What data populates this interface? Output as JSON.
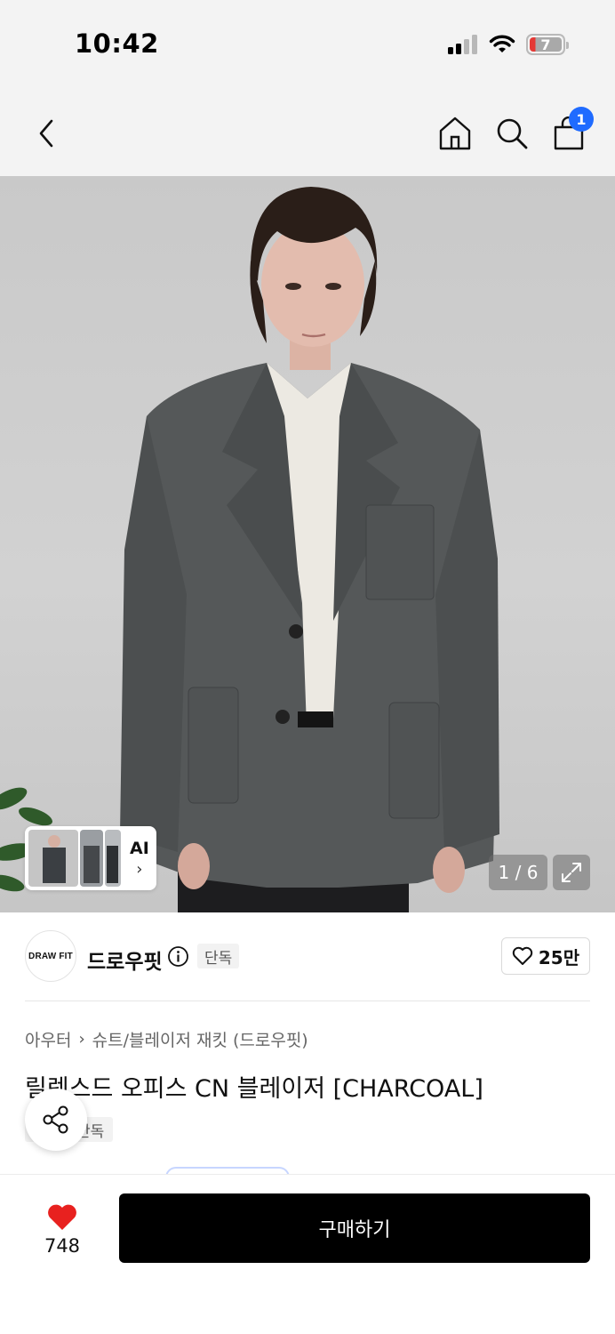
{
  "status_bar": {
    "time": "10:42",
    "battery_level": "7",
    "icons": [
      "cellular-signal-icon",
      "wifi-icon",
      "battery-icon"
    ]
  },
  "nav": {
    "icons": [
      "back-chevron-icon",
      "home-icon",
      "search-icon",
      "shopping-bag-icon"
    ],
    "cart_count": "1"
  },
  "gallery": {
    "ai_label": "AI",
    "ai_chevron": "›",
    "current_page": 1,
    "total_pages": 6,
    "counter_text": "1 / 6"
  },
  "brand": {
    "logo_text": "DRAW FIT",
    "name": "드로우핏",
    "badge": "단독",
    "like_count": "25만"
  },
  "product": {
    "breadcrumb": [
      "아우터",
      "슈트/블레이저 재킷 (드로우핏)"
    ],
    "breadcrumb_sep": "›",
    "title": "릴렉스드 오피스 CN 블레이저 [CHARCOAL]",
    "exclusive_tag": "단독"
  },
  "bottom": {
    "wish_count": "748",
    "buy_label": "구매하기"
  },
  "colors": {
    "accent_blue": "#1f6bff",
    "heart_red": "#e8211f",
    "buy_button": "#000000"
  }
}
